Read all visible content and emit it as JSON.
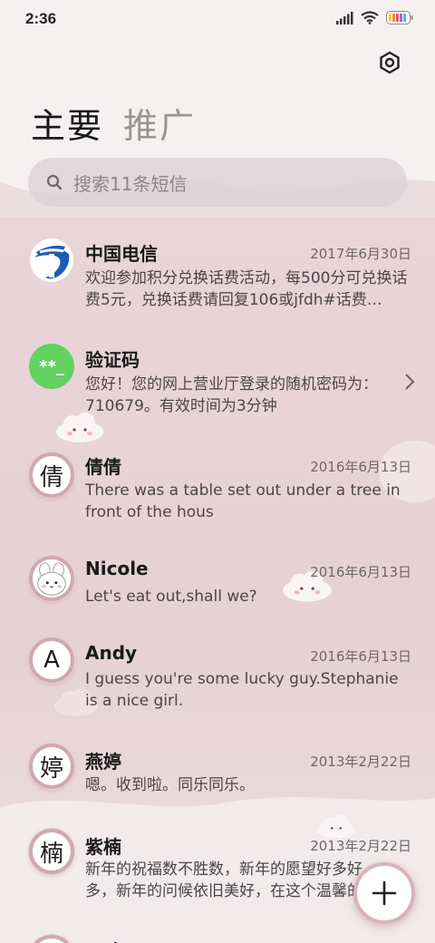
{
  "status_bar": {
    "time": "2:36"
  },
  "tabs": [
    {
      "label": "主要"
    },
    {
      "label": "推广"
    }
  ],
  "search": {
    "placeholder": "搜索11条短信"
  },
  "messages": [
    {
      "name": "中国电信",
      "date": "2017年6月30日",
      "preview": "欢迎参加积分兑换话费活动，每500分可兑换话费5元，兑换话费请回复106或jfdh#话费…",
      "avatar_text": ""
    },
    {
      "name": "验证码",
      "date": "",
      "preview": "您好！您的网上营业厅登录的随机密码为：710679。有效时间为3分钟",
      "avatar_text": "**_"
    },
    {
      "name": "倩倩",
      "date": "2016年6月13日",
      "preview": "There was a table set out under a tree in front of the hous",
      "avatar_text": "倩"
    },
    {
      "name": "Nicole",
      "date": "2016年6月13日",
      "preview": "Let's eat out,shall we?",
      "avatar_text": ""
    },
    {
      "name": "Andy",
      "date": "2016年6月13日",
      "preview": "I guess you're some lucky guy.Stephanie is a nice girl.",
      "avatar_text": "A"
    },
    {
      "name": "燕婷",
      "date": "2013年2月22日",
      "preview": "嗯。收到啦。同乐同乐。",
      "avatar_text": "婷"
    },
    {
      "name": "紫楠",
      "date": "2013年2月22日",
      "preview": "新年的祝福数不胜数，新年的愿望好多好多，新年的问候依旧美好，在这个温馨的时刻",
      "avatar_text": "楠"
    },
    {
      "name": "子玲",
      "date": "",
      "preview": "",
      "avatar_text": ""
    }
  ],
  "colors": {
    "telecom_blue": "#1c5cb6",
    "verify_green": "#63d25f",
    "accent_pink": "#cfa9b0"
  },
  "icons": {
    "settings": "settings-icon",
    "search": "search-icon",
    "chevron": "chevron-right-icon",
    "compose": "plus-icon"
  }
}
